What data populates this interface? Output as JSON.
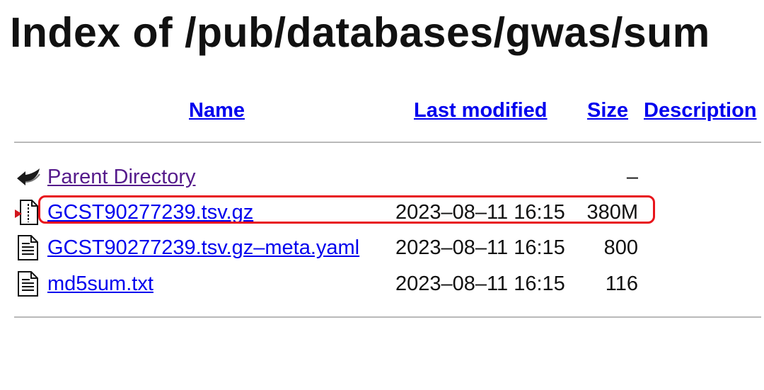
{
  "page": {
    "title": "Index of /pub/databases/gwas/sum"
  },
  "table": {
    "headers": {
      "name": "Name",
      "last_modified": "Last modified",
      "size": "Size",
      "description": "Description"
    },
    "rows": [
      {
        "icon": "back-arrow-icon",
        "name": "Parent Directory",
        "modified": "",
        "size": "–",
        "visited": true
      },
      {
        "icon": "compressed-file-icon",
        "name": "GCST90277239.tsv.gz",
        "modified": "2023–08–11 16:15",
        "size": "380M",
        "visited": false
      },
      {
        "icon": "text-file-icon",
        "name": "GCST90277239.tsv.gz–meta.yaml",
        "modified": "2023–08–11 16:15",
        "size": "800",
        "visited": false
      },
      {
        "icon": "text-file-icon",
        "name": "md5sum.txt",
        "modified": "2023–08–11 16:15",
        "size": "116",
        "visited": false
      }
    ]
  },
  "annotation": {
    "highlight_color": "#e8141b",
    "highlighted_row": 1
  },
  "colors": {
    "link": "#0000ee",
    "visited_link": "#551a8b",
    "rule": "#b9b9b9"
  }
}
